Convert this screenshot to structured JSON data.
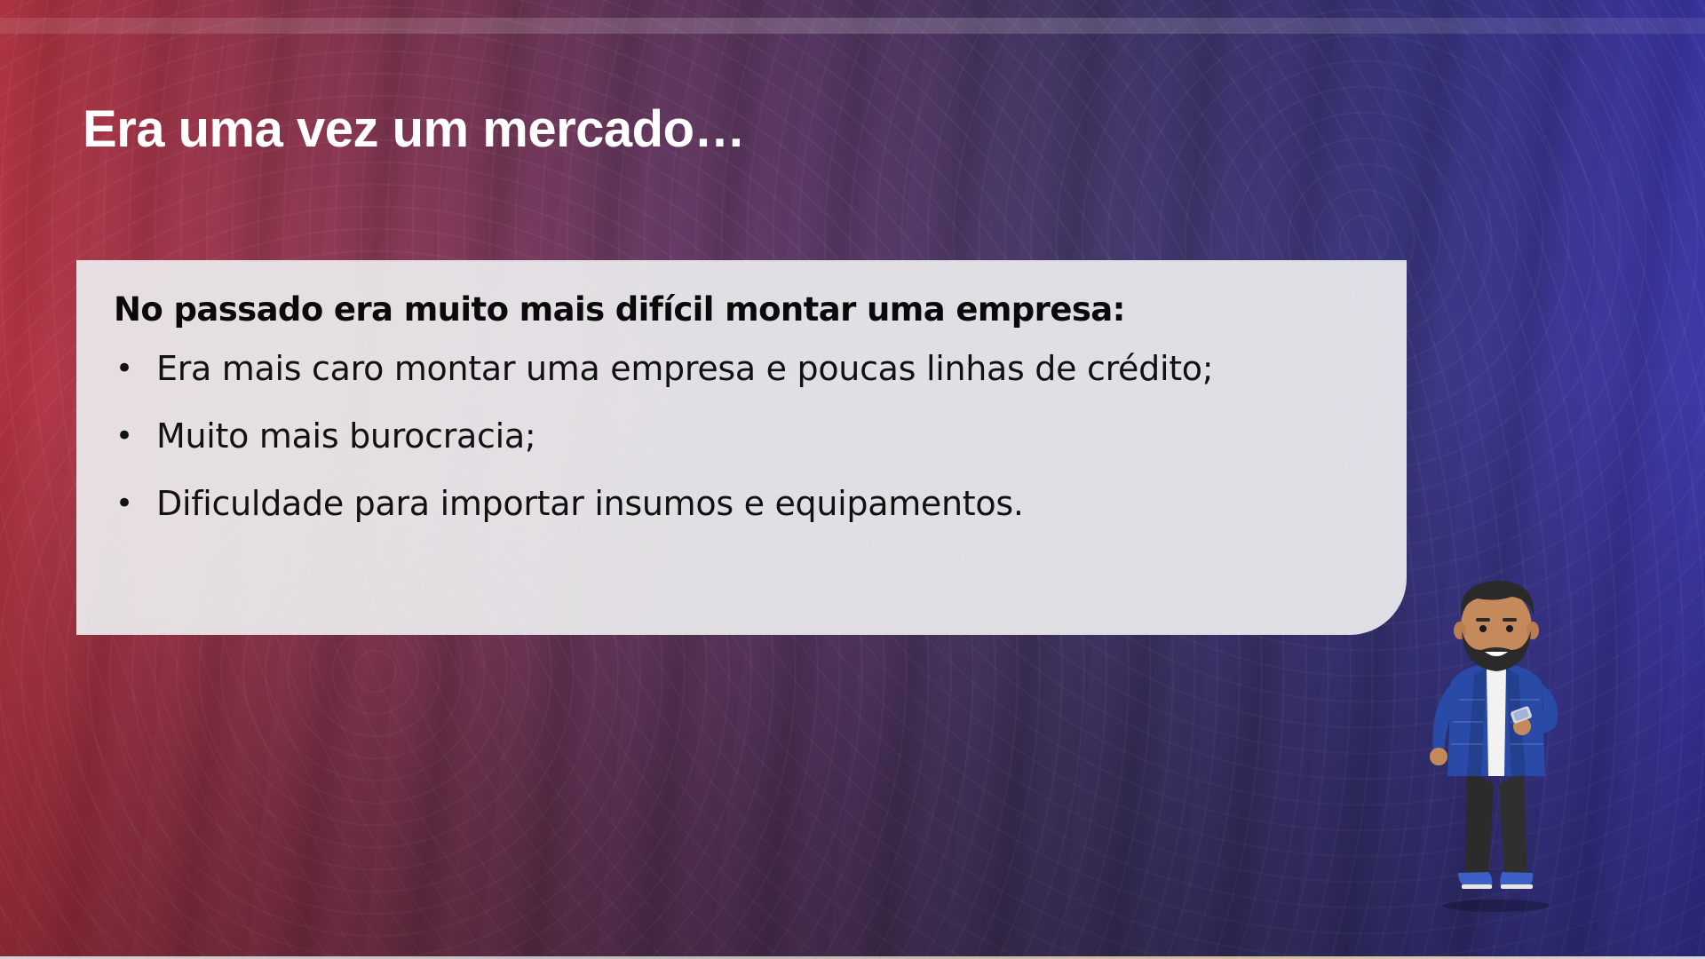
{
  "slide": {
    "title": "Era uma vez um mercado…",
    "card": {
      "heading": "No passado era muito mais difícil montar uma empresa:",
      "bullet_symbol": "•",
      "items": [
        "Era mais caro montar uma empresa e poucas linhas de crédito;",
        "Muito mais burocracia;",
        "Dificuldade para importar insumos e equipamentos."
      ]
    }
  },
  "colors": {
    "background_left": "#b83442",
    "background_right": "#3c37aa",
    "card_background": "#ececee",
    "title_text": "#ffffff",
    "body_text": "#111111",
    "character_jacket": "#2a4aa8"
  },
  "illustration": {
    "icon": "person-with-phone-icon"
  }
}
